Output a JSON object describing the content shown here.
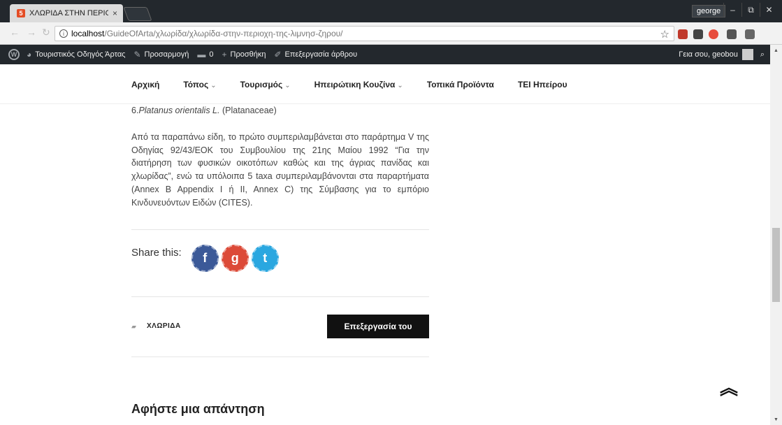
{
  "browser": {
    "tab_title": "ΧΛΩΡΙΔΑ ΣΤΗΝ ΠΕΡΙΟΧΙ",
    "tab_close": "×",
    "user": "george",
    "url_host": "localhost",
    "url_path": "/GuideOfArta/χλωρίδα/χλωρίδα-στην-περιοχη-της-λιμνησ-ζηρου/",
    "window_buttons": [
      "–",
      "⧉",
      "✕"
    ]
  },
  "adminbar": {
    "site": "Τουριστικός Οδηγός Άρτας",
    "customize": "Προσαρμογή",
    "comments_count": "0",
    "new": "Προσθήκη",
    "edit_post": "Επεξεργασία άρθρου",
    "greeting": "Γεια σου, geobou"
  },
  "nav": {
    "items": [
      "Αρχική",
      "Τόπος",
      "Τουρισμός",
      "Ηπειρώτικη Κουζίνα",
      "Τοπικά Προϊόντα",
      "ΤΕΙ Ηπείρου"
    ],
    "caret": "⌄"
  },
  "content": {
    "species_number": "6.",
    "species_name": "Platanus orientalis L.",
    "species_family": "(Platanaceae)",
    "paragraph": "Από τα παραπάνω είδη, το πρώτο συμπεριλαμβάνεται στο παράρτημα V της Οδηγίας 92/43/ΕΟΚ του Συμβουλίου της 21ης Μαίου 1992 “Για την διατήρηση των φυσικών οικοτόπων καθώς και της άγριας πανίδας και χλωρίδας”, ενώ τα υπόλοιπα 5 taxa συμπεριλαμβάνονται στα παραρτήματα (Annex B Appendix I ή II, Annex C) της Σύμβασης για το εμπόριο Κινδυνευόντων Ειδών (CITES)."
  },
  "share": {
    "label": "Share this:",
    "facebook": "f",
    "googleplus": "g",
    "twitter": "t"
  },
  "post_meta": {
    "category": "ΧΛΩΡΙΔΑ",
    "edit_button": "Επεξεργασία του"
  },
  "comments": {
    "title": "Αφήστε μια απάντηση"
  },
  "back_to_top": "≈"
}
